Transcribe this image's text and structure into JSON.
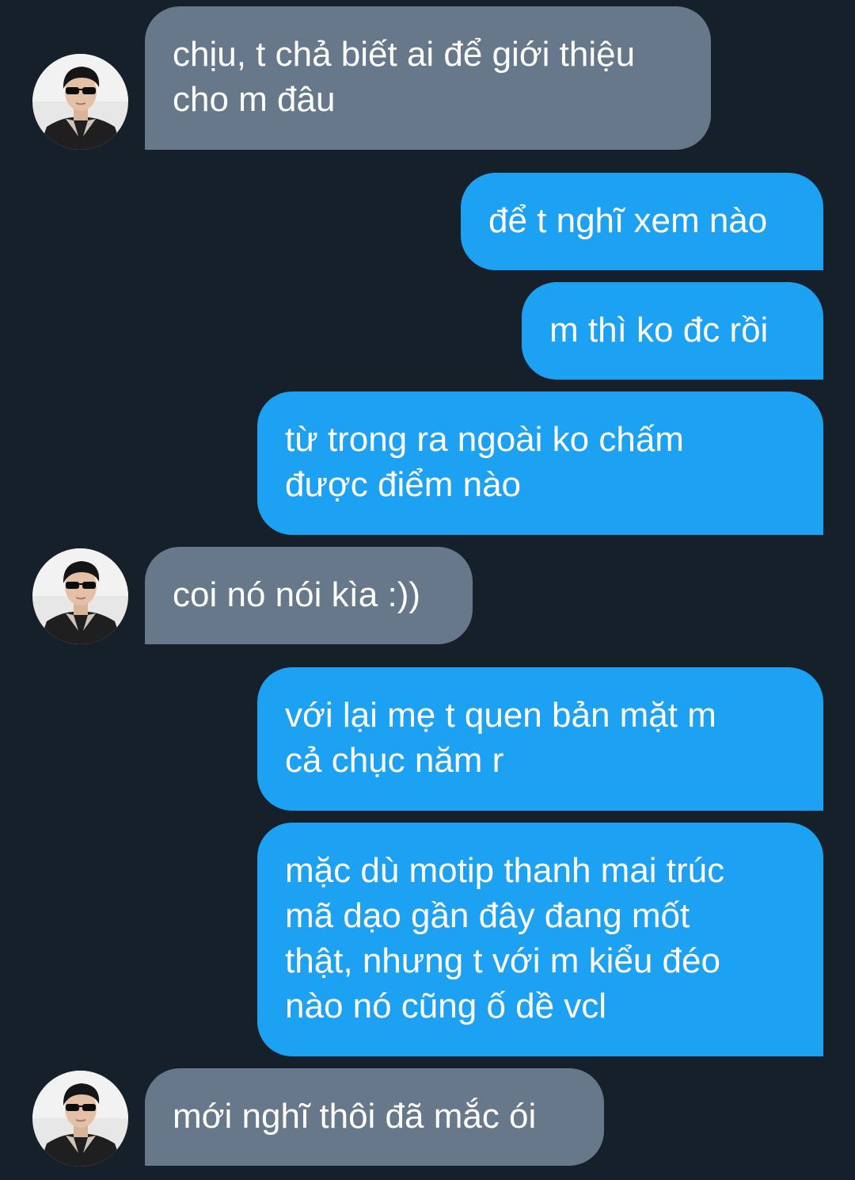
{
  "colors": {
    "background": "#16202b",
    "incoming_bubble": "#66788a",
    "outgoing_bubble": "#1da1f2",
    "text": "#ffffff"
  },
  "avatar_icon": "profile-photo-man-with-sunglasses",
  "messages": [
    {
      "direction": "incoming",
      "text": "chịu, t chả biết ai để giới thiệu\ncho m đâu"
    },
    {
      "direction": "outgoing",
      "text": "để t nghĩ xem nào"
    },
    {
      "direction": "outgoing",
      "text": "m thì ko đc rồi"
    },
    {
      "direction": "outgoing",
      "text": "từ trong ra ngoài ko chấm\nđược điểm nào"
    },
    {
      "direction": "incoming",
      "text": "coi nó nói kìa :))"
    },
    {
      "direction": "outgoing",
      "text": "với lại mẹ t quen bản mặt m\ncả chục năm r"
    },
    {
      "direction": "outgoing",
      "text": "mặc dù motip thanh mai trúc\nmã dạo gần đây đang mốt\nthật, nhưng t với m kiểu đéo\nnào nó cũng ố dề vcl"
    },
    {
      "direction": "incoming",
      "text": "mới nghĩ thôi đã mắc ói"
    }
  ]
}
